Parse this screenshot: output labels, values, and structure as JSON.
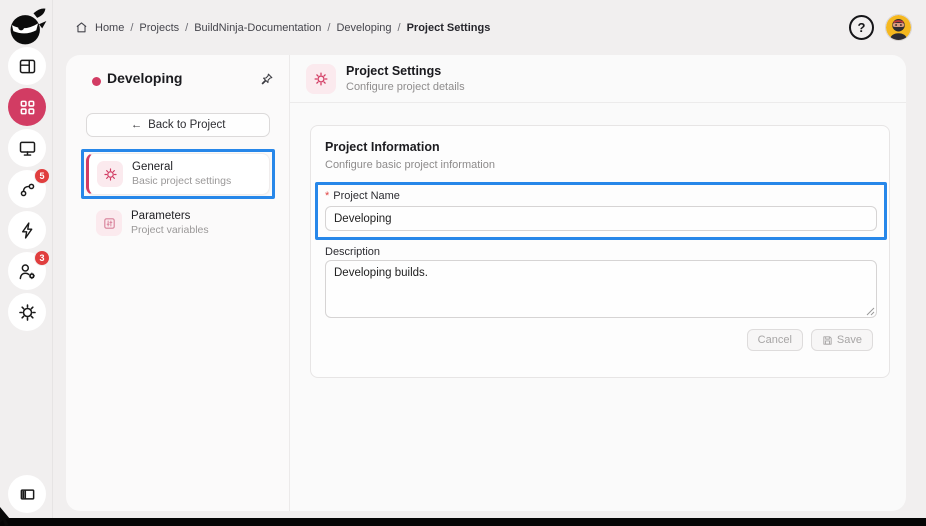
{
  "app": {
    "name": "BuildNinja"
  },
  "topbar": {
    "sep": "/",
    "breadcrumb": [
      "Home",
      "Projects",
      "BuildNinja-Documentation",
      "Developing",
      "Project Settings"
    ],
    "help_label": "?"
  },
  "rail": {
    "items": [
      {
        "icon": "dashboard-icon"
      },
      {
        "icon": "projects-grid-icon",
        "active": true
      },
      {
        "icon": "monitor-icon"
      },
      {
        "icon": "pipelines-icon",
        "badge": "5"
      },
      {
        "icon": "actions-bolt-icon"
      },
      {
        "icon": "user-settings-icon",
        "badge": "3"
      },
      {
        "icon": "settings-gear-icon"
      }
    ],
    "bottom_item": {
      "icon": "sidebar-toggle-icon"
    }
  },
  "sidebar": {
    "project": {
      "name": "Developing"
    },
    "back_arrow": "←",
    "back_button_label": "Back to Project",
    "items": [
      {
        "label": "General",
        "description": "Basic project settings",
        "active": true
      },
      {
        "label": "Parameters",
        "description": "Project variables",
        "active": false
      }
    ]
  },
  "main": {
    "header": {
      "title": "Project Settings",
      "subtitle": "Configure project details"
    },
    "card": {
      "title": "Project Information",
      "subtitle": "Configure basic project information",
      "required_marker": "*",
      "fields": [
        {
          "label": "Project Name",
          "value": "Developing"
        },
        {
          "label": "Description",
          "value": "Developing builds."
        }
      ],
      "actions": {
        "cancel": "Cancel",
        "save": "Save"
      }
    }
  },
  "colors": {
    "accent": "#d23c63",
    "annotation_blue": "#2787e9",
    "badge_red": "#e03e3e",
    "avatar_yellow": "#f5b81f"
  }
}
